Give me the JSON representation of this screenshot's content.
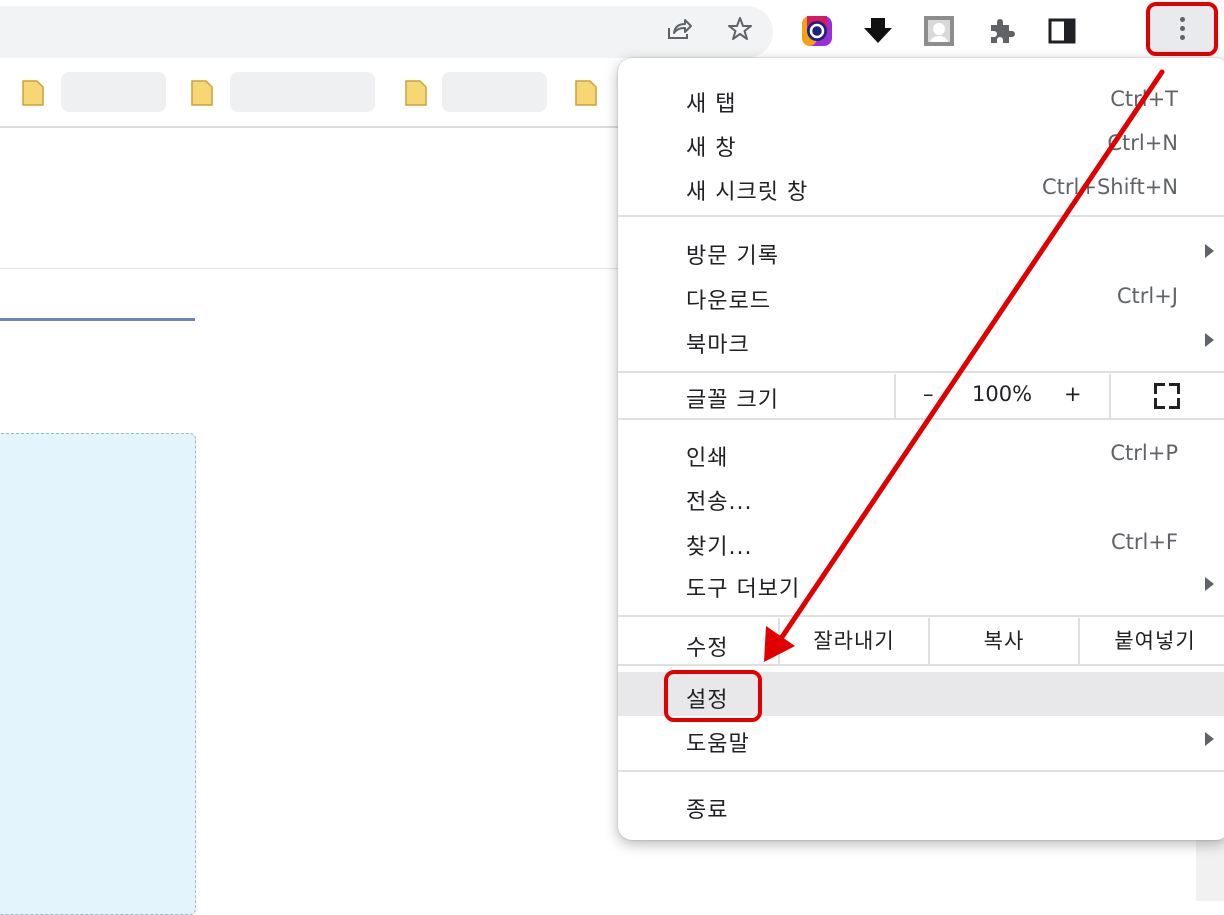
{
  "menu": {
    "items": [
      {
        "label": "새 탭",
        "shortcut": "Ctrl+T"
      },
      {
        "label": "새 창",
        "shortcut": "Ctrl+N"
      },
      {
        "label": "새 시크릿 창",
        "shortcut": "Ctrl+Shift+N"
      },
      {
        "label": "방문 기록",
        "submenu": true
      },
      {
        "label": "다운로드",
        "shortcut": "Ctrl+J"
      },
      {
        "label": "북마크",
        "submenu": true
      },
      {
        "label": "인쇄",
        "shortcut": "Ctrl+P"
      },
      {
        "label": "전송...",
        "shortcut": ""
      },
      {
        "label": "찾기...",
        "shortcut": "Ctrl+F"
      },
      {
        "label": "도구 더보기",
        "submenu": true
      },
      {
        "label": "설정",
        "shortcut": ""
      },
      {
        "label": "도움말",
        "submenu": true
      },
      {
        "label": "종료",
        "shortcut": ""
      }
    ],
    "zoom": {
      "label": "글꼴 크기",
      "minus": "–",
      "value": "100%",
      "plus": "+"
    },
    "edit": {
      "label": "수정",
      "cut": "잘라내기",
      "copy": "복사",
      "paste": "붙여넣기"
    }
  },
  "toolbar": {
    "icons": [
      "share-icon",
      "star-icon",
      "color-extension-icon",
      "download-arrow-icon",
      "profile-extension-icon",
      "puzzle-icon",
      "side-panel-icon",
      "more-vert-icon"
    ]
  },
  "colors": {
    "highlight": "#e00000",
    "hover": "#e8e8ea",
    "folder": "#f7d774",
    "card": "#e3f4fc"
  }
}
